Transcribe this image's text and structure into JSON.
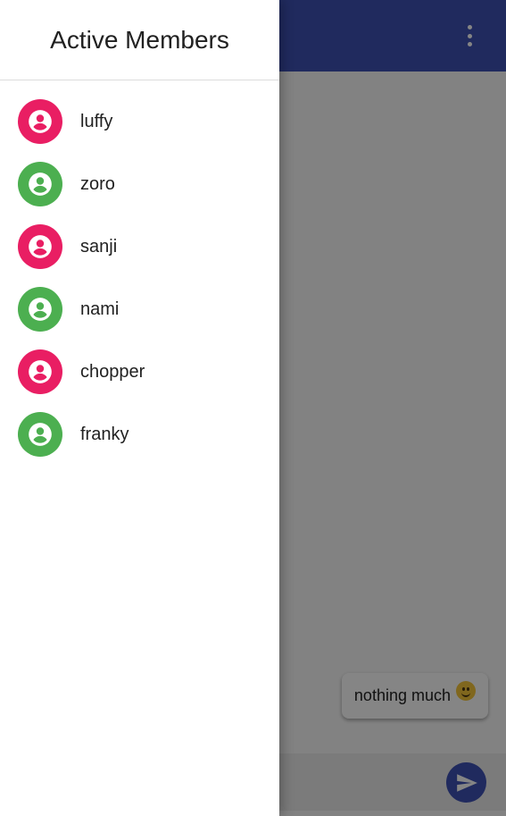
{
  "drawer": {
    "title": "Active Members",
    "members": [
      {
        "name": "luffy",
        "avatar_color": "#e91e63",
        "icon": "account-circle-icon"
      },
      {
        "name": "zoro",
        "avatar_color": "#4caf50",
        "icon": "account-circle-icon"
      },
      {
        "name": "sanji",
        "avatar_color": "#e91e63",
        "icon": "account-circle-icon"
      },
      {
        "name": "nami",
        "avatar_color": "#4caf50",
        "icon": "account-circle-icon"
      },
      {
        "name": "chopper",
        "avatar_color": "#e91e63",
        "icon": "account-circle-icon"
      },
      {
        "name": "franky",
        "avatar_color": "#4caf50",
        "icon": "account-circle-icon"
      }
    ]
  },
  "appbar": {
    "color": "#3f51b5",
    "menu_icon": "more-vert-icon"
  },
  "chat": {
    "messages": [
      {
        "text": "nothing much",
        "emoji": "slightly-smiling-face"
      }
    ],
    "send_icon": "send-icon",
    "accent": "#3f51b5"
  }
}
